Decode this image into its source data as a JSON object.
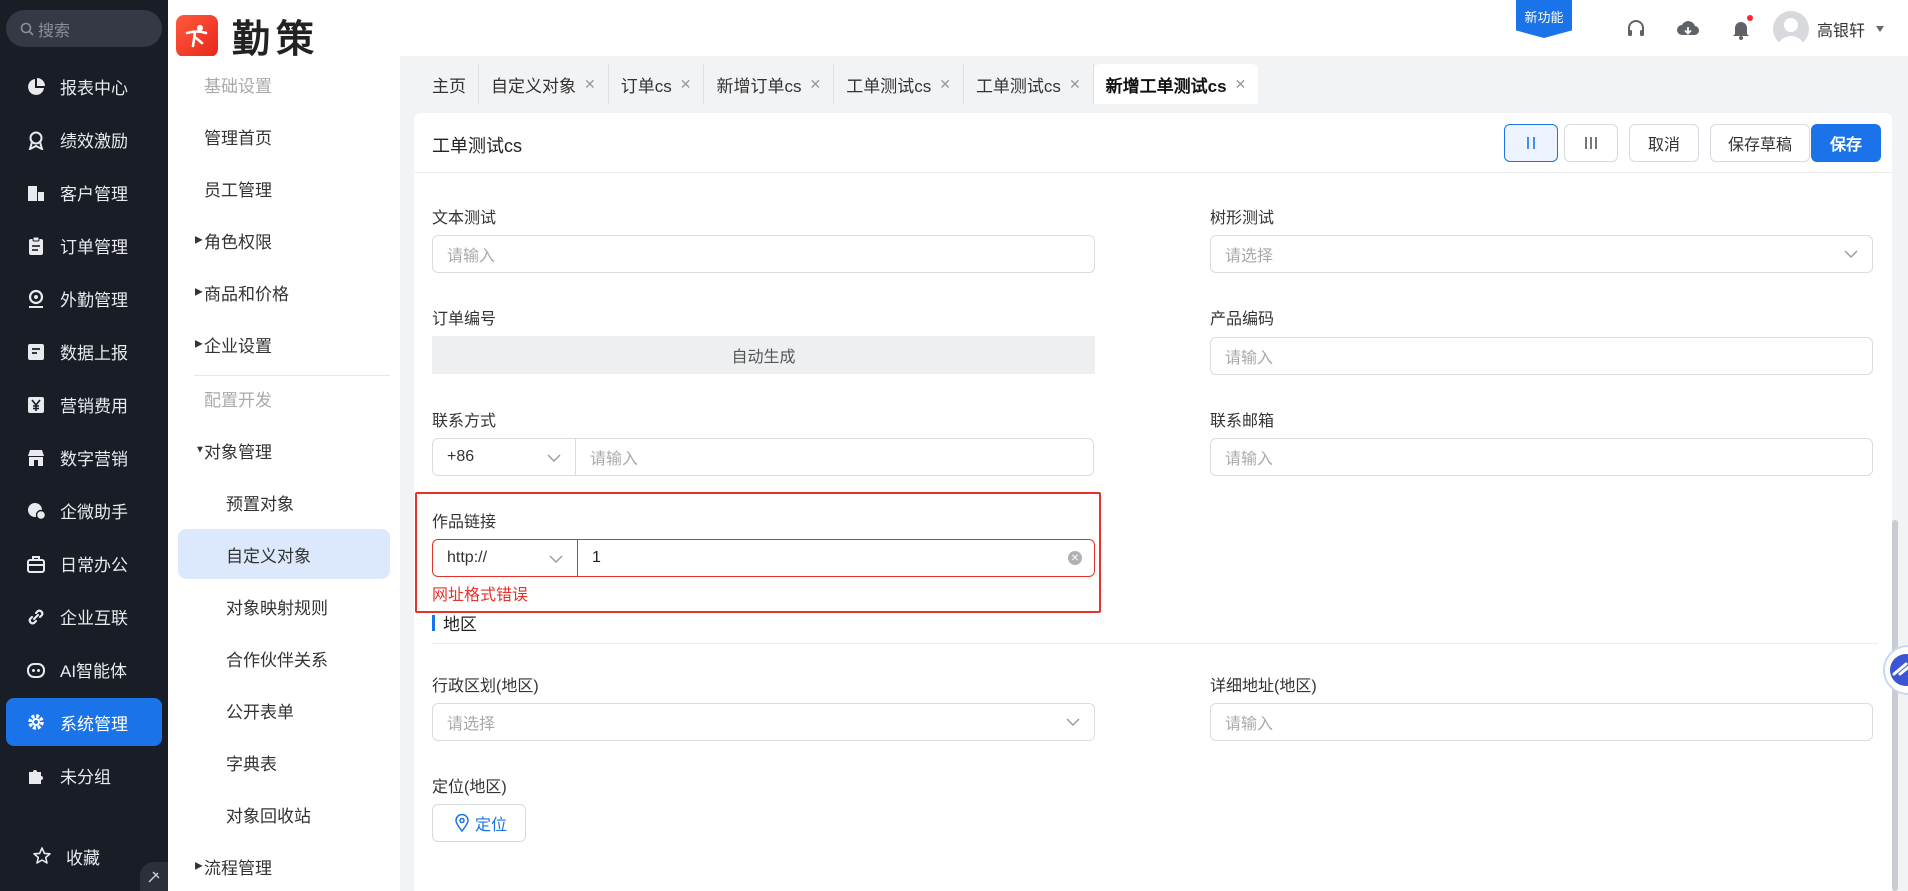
{
  "nav": {
    "search_placeholder": "搜索",
    "items": [
      {
        "label": "报表中心",
        "icon": "pie-chart-icon"
      },
      {
        "label": "绩效激励",
        "icon": "award-icon"
      },
      {
        "label": "客户管理",
        "icon": "customer-icon"
      },
      {
        "label": "订单管理",
        "icon": "clipboard-icon"
      },
      {
        "label": "外勤管理",
        "icon": "location-pin-icon"
      },
      {
        "label": "数据上报",
        "icon": "report-icon"
      },
      {
        "label": "营销费用",
        "icon": "yen-icon"
      },
      {
        "label": "数字营销",
        "icon": "store-icon"
      },
      {
        "label": "企微助手",
        "icon": "chat-icon"
      },
      {
        "label": "日常办公",
        "icon": "briefcase-icon"
      },
      {
        "label": "企业互联",
        "icon": "link-icon"
      },
      {
        "label": "AI智能体",
        "icon": "robot-icon"
      },
      {
        "label": "系统管理",
        "icon": "gear-icon",
        "active": true
      },
      {
        "label": "未分组",
        "icon": "puzzle-icon"
      }
    ],
    "favorites": "收藏"
  },
  "header": {
    "brand": "勤策",
    "new_feature": "新功能",
    "user_name": "高银轩"
  },
  "subnav": {
    "items": [
      {
        "label": "基础设置",
        "kind": "group"
      },
      {
        "label": "管理首页",
        "kind": "item"
      },
      {
        "label": "员工管理",
        "kind": "item"
      },
      {
        "label": "角色权限",
        "kind": "collapsed"
      },
      {
        "label": "商品和价格",
        "kind": "collapsed"
      },
      {
        "label": "企业设置",
        "kind": "collapsed"
      },
      {
        "label": "配置开发",
        "kind": "group"
      },
      {
        "label": "对象管理",
        "kind": "expanded"
      },
      {
        "label": "预置对象",
        "kind": "child"
      },
      {
        "label": "自定义对象",
        "kind": "child",
        "active": true
      },
      {
        "label": "对象映射规则",
        "kind": "child"
      },
      {
        "label": "合作伙伴关系",
        "kind": "child"
      },
      {
        "label": "公开表单",
        "kind": "child"
      },
      {
        "label": "字典表",
        "kind": "child"
      },
      {
        "label": "对象回收站",
        "kind": "child"
      },
      {
        "label": "流程管理",
        "kind": "collapsed"
      }
    ]
  },
  "tabs": [
    {
      "label": "主页",
      "closable": false
    },
    {
      "label": "自定义对象",
      "closable": true
    },
    {
      "label": "订单cs",
      "closable": true
    },
    {
      "label": "新增订单cs",
      "closable": true
    },
    {
      "label": "工单测试cs",
      "closable": true
    },
    {
      "label": "工单测试cs",
      "closable": true
    },
    {
      "label": "新增工单测试cs",
      "closable": true,
      "active": true
    }
  ],
  "form": {
    "title": "工单测试cs",
    "buttons": {
      "cancel": "取消",
      "save_draft": "保存草稿",
      "save": "保存"
    },
    "text_test": {
      "label": "文本测试",
      "placeholder": "请输入"
    },
    "tree_test": {
      "label": "树形测试",
      "placeholder": "请选择"
    },
    "order_no": {
      "label": "订单编号",
      "value": "自动生成"
    },
    "product_code": {
      "label": "产品编码",
      "placeholder": "请输入"
    },
    "contact": {
      "label": "联系方式",
      "prefix": "+86",
      "placeholder": "请输入"
    },
    "email": {
      "label": "联系邮箱",
      "placeholder": "请输入"
    },
    "work_link": {
      "label": "作品链接",
      "prefix": "http://",
      "value": "1",
      "error": "网址格式错误"
    },
    "section_region": "地区",
    "admin_region": {
      "label": "行政区划(地区)",
      "placeholder": "请选择"
    },
    "detail_address": {
      "label": "详细地址(地区)",
      "placeholder": "请输入"
    },
    "location": {
      "label": "定位(地区)",
      "button": "定位"
    }
  },
  "colors": {
    "primary": "#1a73e8",
    "error": "#e5322d",
    "nav_bg": "#191d26"
  }
}
